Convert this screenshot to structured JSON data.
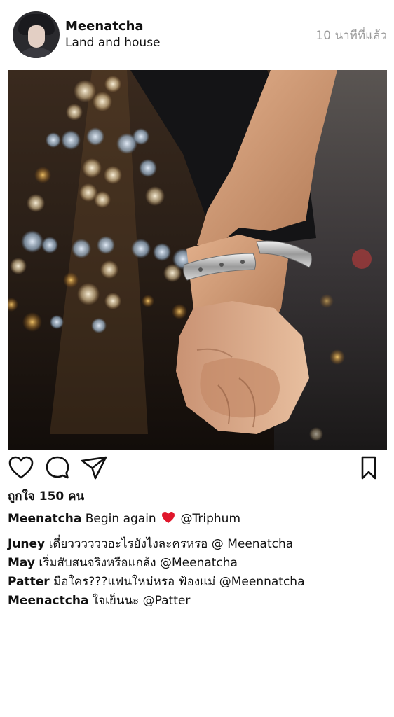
{
  "post": {
    "user": {
      "name": "Meenatcha",
      "location": "Land and house",
      "avatar_icon": "profile-photo"
    },
    "time_ago": "10 นาทีที่แล้ว",
    "photo_icon": "holding-hands-photo",
    "actions": {
      "like_icon": "heart-outline-icon",
      "comment_icon": "speech-bubble-icon",
      "share_icon": "paper-plane-icon",
      "save_icon": "bookmark-icon"
    },
    "likes_text": "ถูกใจ 150 คน",
    "caption": {
      "user": "Meenatcha",
      "text_before": "Begin again",
      "emoji": "red-heart",
      "mention": "@Triphum"
    },
    "comments": [
      {
        "user": "Juney",
        "text": "เดี๋ยววววววอะไรยังไงละครหรอ @ Meenatcha"
      },
      {
        "user": "May",
        "text": "เริ่มสับสนจริงหรือแกล้ง @Meenatcha"
      },
      {
        "user": "Patter",
        "text": "มือใคร???แฟนใหม่หรอ ฟ้องแม่ @Meennatcha"
      },
      {
        "user": "Meenactcha",
        "text": "ใจเย็นนะ @Patter"
      }
    ],
    "colors": {
      "heart_emoji": "#e0162b",
      "time_text": "#9a9a9a",
      "text": "#111111"
    }
  }
}
